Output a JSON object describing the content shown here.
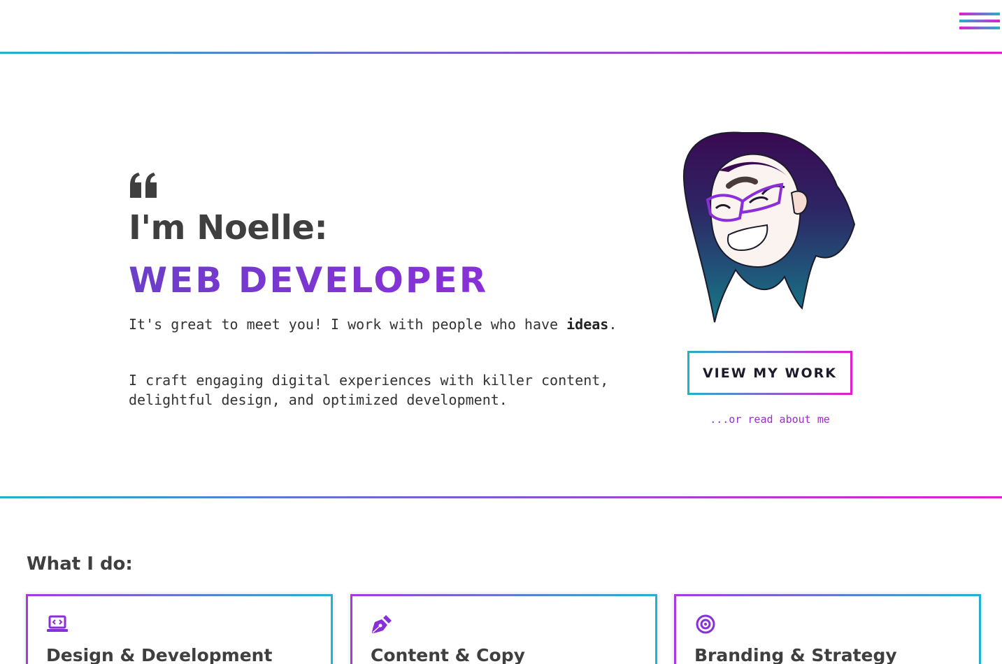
{
  "header": {
    "menu_icon": "hamburger-icon"
  },
  "hero": {
    "quote_icon": "quote-left-icon",
    "name": "I'm Noelle:",
    "role": "WEB DEVELOPER",
    "intro_text": "It's great to meet you! I work with people who have ",
    "intro_strong": "ideas",
    "intro_end": ".",
    "craft_text": "I craft engaging digital experiences with killer content, delightful design, and optimized development.",
    "avatar": "avatar-illustration",
    "cta_label": "VIEW MY WORK",
    "secondary_link": "...or read about me"
  },
  "services": {
    "title": "What I do:",
    "items": [
      {
        "icon": "laptop-code-icon",
        "title": "Design & Development"
      },
      {
        "icon": "pen-nib-icon",
        "title": "Content & Copy"
      },
      {
        "icon": "bullseye-icon",
        "title": "Branding & Strategy"
      }
    ]
  },
  "colors": {
    "accent_teal": "#22b2c9",
    "accent_magenta": "#e51ad0",
    "accent_purple": "#8a2fd8",
    "text_dark": "#3f3f3f"
  }
}
